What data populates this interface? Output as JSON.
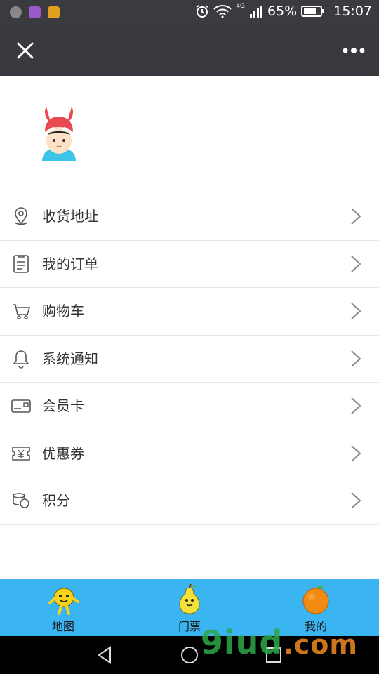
{
  "status_bar": {
    "network": "4G",
    "battery": "65%",
    "time": "15:07"
  },
  "header": {
    "close_icon": "close-icon",
    "more_icon": "more-dots-icon"
  },
  "menu": {
    "items": [
      {
        "label": "收货地址",
        "icon": "location-pin-icon"
      },
      {
        "label": "我的订单",
        "icon": "order-list-icon"
      },
      {
        "label": "购物车",
        "icon": "cart-icon"
      },
      {
        "label": "系统通知",
        "icon": "bell-icon"
      },
      {
        "label": "会员卡",
        "icon": "card-icon"
      },
      {
        "label": "优惠券",
        "icon": "coupon-icon"
      },
      {
        "label": "积分",
        "icon": "coins-icon"
      }
    ]
  },
  "tabbar": {
    "color": "#3bb4f2",
    "tabs": [
      {
        "label": "地图",
        "icon": "lemon-mascot-icon"
      },
      {
        "label": "门票",
        "icon": "pear-mascot-icon"
      },
      {
        "label": "我的",
        "icon": "orange-icon"
      }
    ]
  },
  "watermark": {
    "text": "9iud",
    "suffix": ".com"
  }
}
